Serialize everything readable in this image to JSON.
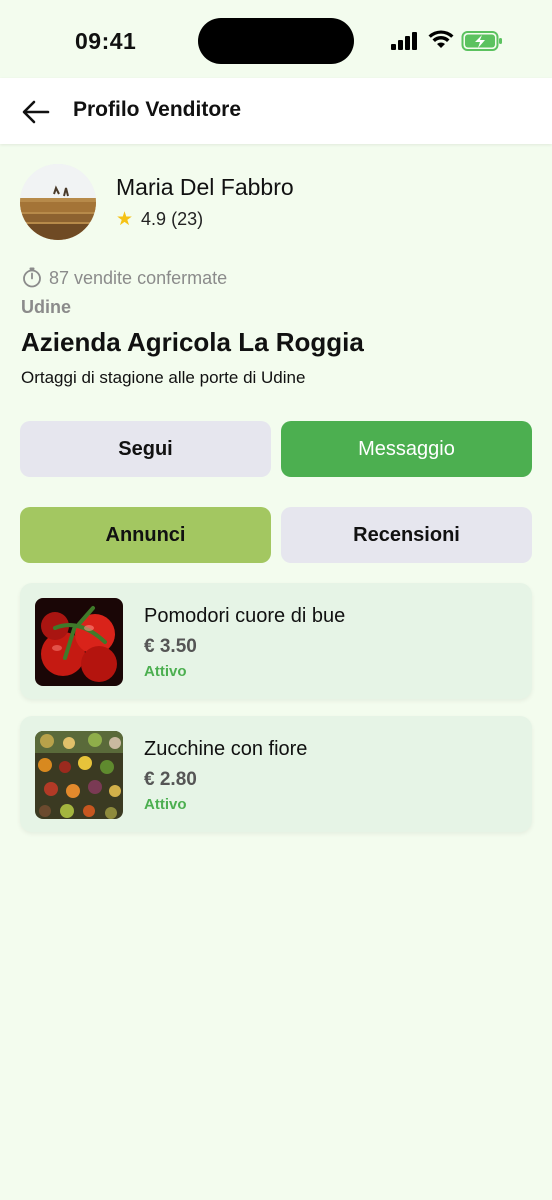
{
  "status_bar": {
    "time": "09:41"
  },
  "header": {
    "title": "Profilo Venditore"
  },
  "seller": {
    "name": "Maria Del Fabbro",
    "rating": "4.9",
    "reviews_count": "(23)",
    "confirmed_sales": "87 vendite confermate",
    "city": "Udine",
    "farm_name": "Azienda Agricola La Roggia",
    "description": "Ortaggi di stagione alle porte di Udine"
  },
  "actions": {
    "follow": "Segui",
    "message": "Messaggio"
  },
  "tabs": {
    "ads": "Annunci",
    "reviews": "Recensioni",
    "active": "ads"
  },
  "listings": [
    {
      "title": "Pomodori cuore di bue",
      "price": "€ 3.50",
      "status": "Attivo"
    },
    {
      "title": "Zucchine con fiore",
      "price": "€ 2.80",
      "status": "Attivo"
    }
  ],
  "colors": {
    "background": "#f3fcee",
    "primary_green": "#4caf50",
    "active_tab": "#a3c761",
    "card_bg": "#e6f4e6",
    "star": "#f5c215"
  }
}
